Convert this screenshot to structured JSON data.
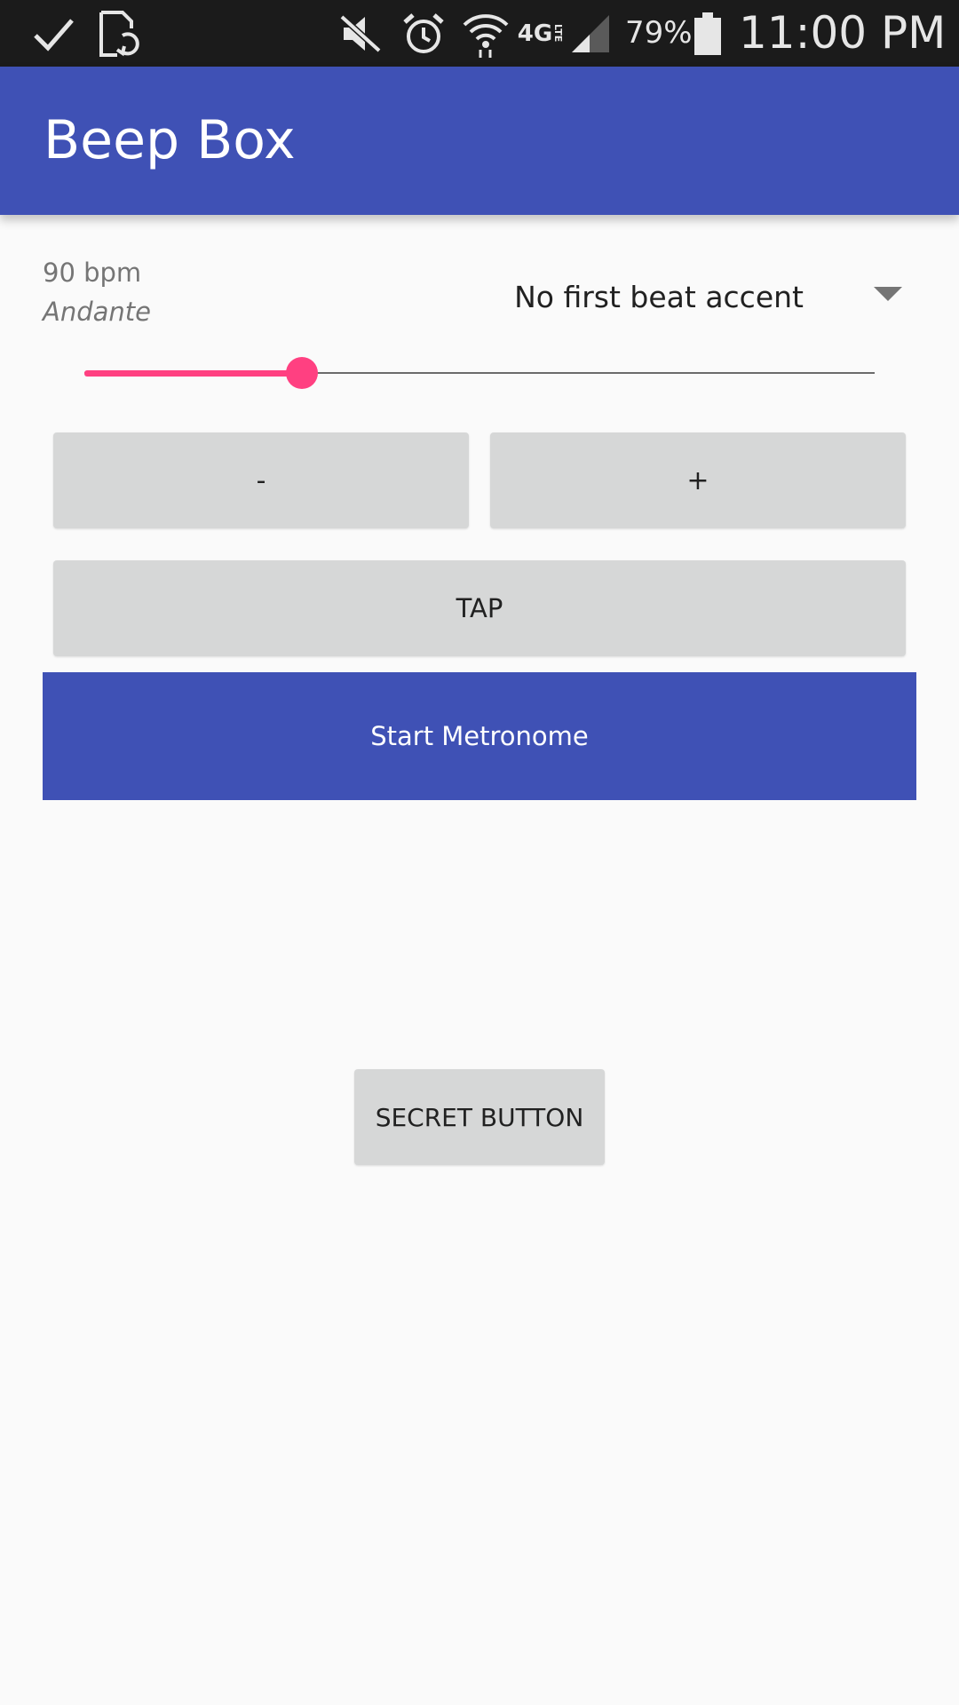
{
  "status_bar": {
    "icons": [
      "check-icon",
      "screen-rotation-icon",
      "mute-icon",
      "alarm-icon",
      "wifi-icon",
      "4g-lte-icon",
      "signal-icon",
      "battery-icon"
    ],
    "network_label": "4G",
    "network_sub_label": "LTE",
    "battery": "79%",
    "time": "11:00 PM"
  },
  "app_bar": {
    "title": "Beep Box",
    "color": "#3f51b5"
  },
  "tempo": {
    "bpm_text": "90 bpm",
    "tempo_name": "Andante"
  },
  "accent_spinner": {
    "selected": "No first beat accent"
  },
  "slider": {
    "value_fraction": 0.275,
    "accent_color": "#ff4081"
  },
  "buttons": {
    "decrement": "-",
    "increment": "+",
    "tap": "TAP",
    "start": "Start Metronome",
    "secret": "SECRET BUTTON"
  }
}
